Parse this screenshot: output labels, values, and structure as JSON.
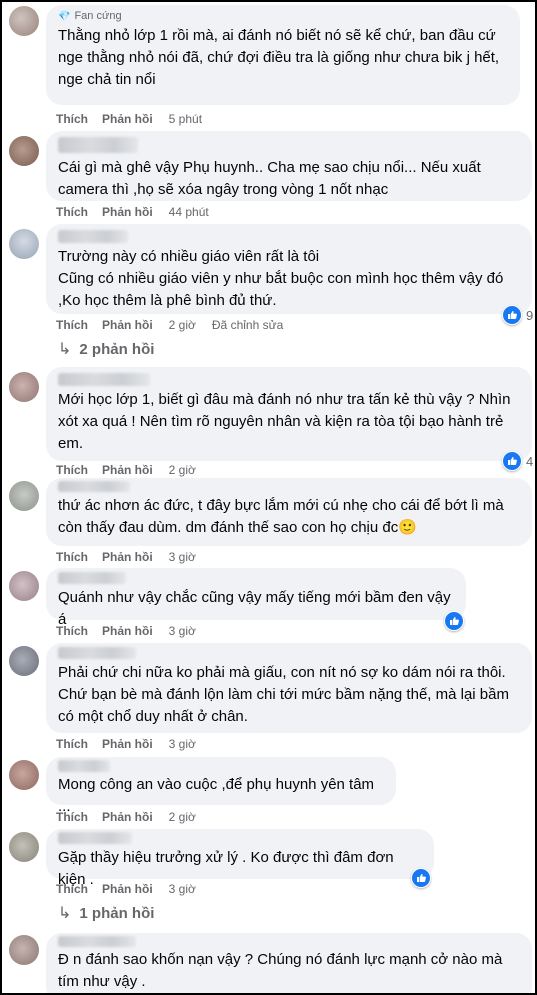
{
  "actions": {
    "like": "Thích",
    "reply": "Phản hồi"
  },
  "comments": [
    {
      "badge": "Fan cứng",
      "text": "Thằng nhỏ lớp 1 rồi mà, ai đánh nó biết nó sẽ kể chứ, ban đầu cứ nge thằng nhỏ nói đã, chứ đợi điều tra là giống như chưa bik j hết, nge chả tin nổi",
      "time": "5 phút"
    },
    {
      "text": "Cái gì mà ghê vậy Phụ huynh.. Cha mẹ sao chịu nổi... Nếu xuất camera thì ,họ sẽ xóa ngây trong vòng 1 nốt nhạc",
      "time": "44 phút"
    },
    {
      "text": "Trường này có nhiều giáo viên rất là tôi\nCũng có nhiều giáo viên y như bắt buộc con mình học thêm vậy đó ,Ko học thêm là phê bình đủ thứ.",
      "time": "2 giờ",
      "edited": "Đã chỉnh sửa",
      "reactions": "9",
      "replies": "2 phản hồi"
    },
    {
      "text": "Mới học lớp 1, biết gì đâu mà đánh nó như tra tấn kẻ thù vậy ? Nhìn xót xa quá ! Nên tìm rõ nguyên nhân và kiện ra tòa tội bạo hành trẻ em.",
      "time": "2 giờ",
      "reactions": "4"
    },
    {
      "text": "thứ ác nhơn ác đức, t đây bực lắm mới cú nhẹ cho cái để bớt lì mà còn thấy đau dùm. dm đánh thế sao con họ chịu đc",
      "emoji": "🙂",
      "time": "3 giờ"
    },
    {
      "text": "Quánh như vậy chắc cũng vậy mấy tiếng mới bầm đen vậy á",
      "time": "3 giờ"
    },
    {
      "text": "Phải chứ chi nữa ko phải mà giấu, con nít nó sợ ko dám nói ra thôi. Chứ bạn bè mà đánh lộn làm chi tới mức bầm nặng thế, mà lại bầm có một chổ duy nhất ở chân.",
      "time": "3 giờ"
    },
    {
      "text": "Mong công an vào cuộc ,để phụ huynh yên tâm ...",
      "time": "2 giờ"
    },
    {
      "text": "Gặp thầy hiệu trưởng xử lý . Ko được thì đâm đơn kiện .",
      "time": "3 giờ",
      "replies": "1 phản hồi"
    },
    {
      "text": "Đ n đánh sao khốn nạn vậy ? Chúng nó đánh lực mạnh cở nào mà tím như vậy ."
    }
  ],
  "colors": {
    "like": "#1877f2",
    "bubble": "#f0f2f5",
    "meta": "#65676b"
  },
  "icons": {
    "like": "thumbs-up-icon",
    "badge": "diamond-icon",
    "reply_arrow": "reply-arrow-icon"
  }
}
